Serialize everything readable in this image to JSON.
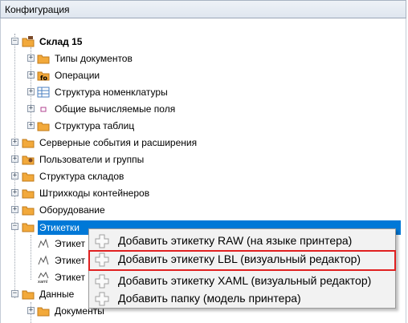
{
  "window": {
    "title": "Конфигурация"
  },
  "tree": {
    "root": {
      "label": "Склад 15"
    },
    "root_children": [
      {
        "label": "Типы документов"
      },
      {
        "label": "Операции"
      },
      {
        "label": "Структура номенклатуры"
      },
      {
        "label": "Общие вычисляемые поля"
      },
      {
        "label": "Структура таблиц"
      }
    ],
    "top_items": [
      {
        "label": "Серверные события и расширения"
      },
      {
        "label": "Пользователи и группы"
      },
      {
        "label": "Структура складов"
      },
      {
        "label": "Штрихкоды контейнеров"
      },
      {
        "label": "Оборудование"
      }
    ],
    "selected": {
      "label": "Этикетки"
    },
    "label_children": [
      {
        "label": "Этикет"
      },
      {
        "label": "Этикет"
      },
      {
        "label": "Этикет"
      }
    ],
    "data_node": {
      "label": "Данные"
    },
    "data_children": [
      {
        "label": "Документы"
      }
    ]
  },
  "context_menu": {
    "items": [
      {
        "label": "Добавить этикетку RAW (на языке принтера)"
      },
      {
        "label": "Добавить этикетку LBL (визуальный редактор)",
        "highlighted": true
      },
      {
        "label": "Добавить этикетку XAML (визуальный редактор)"
      },
      {
        "label": "Добавить папку (модель принтера)"
      }
    ]
  },
  "colors": {
    "selection": "#0078d7",
    "highlight_border": "#e02020",
    "folder": "#f2a93b"
  },
  "icons": {
    "expand": "plus-box-icon",
    "collapse": "minus-box-icon",
    "folder": "folder-icon",
    "menu_add": "add-plus-icon"
  }
}
